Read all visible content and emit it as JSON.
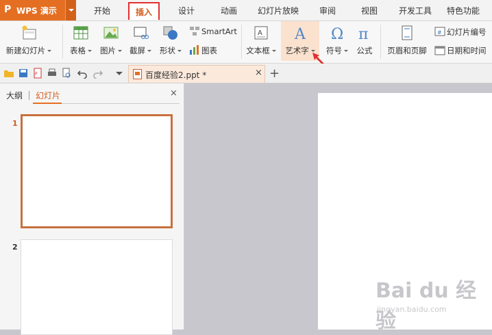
{
  "app": {
    "logo": "P",
    "name": "WPS 演示"
  },
  "menu": {
    "tabs": [
      {
        "label": "开始"
      },
      {
        "label": "插入"
      },
      {
        "label": "设计"
      },
      {
        "label": "动画"
      },
      {
        "label": "幻灯片放映"
      },
      {
        "label": "审阅"
      },
      {
        "label": "视图"
      },
      {
        "label": "开发工具"
      },
      {
        "label": "特色功能"
      }
    ],
    "active": "插入"
  },
  "ribbon": {
    "new_slide": "新建幻灯片",
    "table": "表格",
    "picture": "图片",
    "screenshot": "截屏",
    "shapes": "形状",
    "smartart": "SmartArt",
    "chart": "图表",
    "textbox": "文本框",
    "wordart": "艺术字",
    "symbol": "符号",
    "equation": "公式",
    "header_footer": "页眉和页脚",
    "slide_number": "幻灯片编号",
    "date_time": "日期和时间"
  },
  "document_tab": {
    "name": "百度经验2.ppt *",
    "close": "×"
  },
  "new_tab": "+",
  "panel": {
    "tab_outline": "大纲",
    "tab_slides": "幻灯片",
    "close": "×",
    "slide_numbers": [
      "1",
      "2"
    ]
  },
  "watermark": {
    "brand": "Bai du 经验",
    "url": "jingyan.baidu.com"
  },
  "colors": {
    "accent": "#e46f22",
    "highlight_border": "#e03030",
    "selected_slide_border": "#c8703d"
  }
}
